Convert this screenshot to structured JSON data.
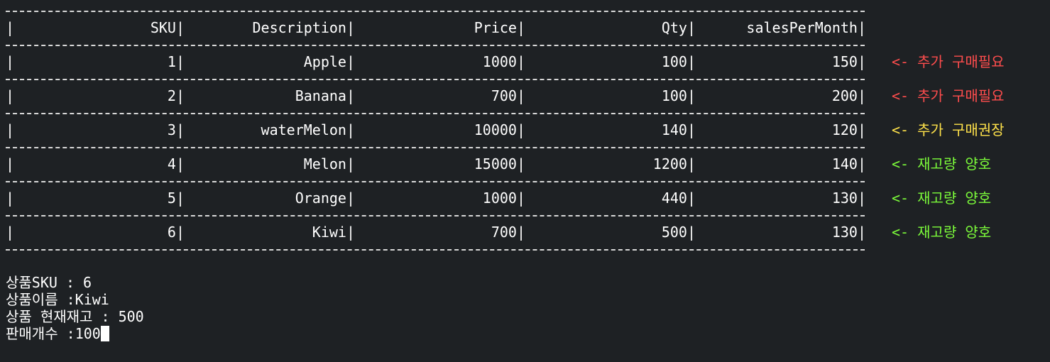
{
  "table": {
    "headers": [
      "SKU",
      "Description",
      "Price",
      "Qty",
      "salesPerMonth"
    ],
    "rows": [
      {
        "sku": "1",
        "description": "Apple",
        "price": "1000",
        "qty": "100",
        "sales": "150",
        "status_arrow": "<-",
        "status_text": "추가 구매필요",
        "status_color": "#ff4d4d"
      },
      {
        "sku": "2",
        "description": "Banana",
        "price": "700",
        "qty": "100",
        "sales": "200",
        "status_arrow": "<-",
        "status_text": "추가 구매필요",
        "status_color": "#ff4d4d"
      },
      {
        "sku": "3",
        "description": "waterMelon",
        "price": "10000",
        "qty": "140",
        "sales": "120",
        "status_arrow": "<-",
        "status_text": "추가 구매권장",
        "status_color": "#ffe24a"
      },
      {
        "sku": "4",
        "description": "Melon",
        "price": "15000",
        "qty": "1200",
        "sales": "140",
        "status_arrow": "<-",
        "status_text": "재고량 양호",
        "status_color": "#7cfc3a"
      },
      {
        "sku": "5",
        "description": "Orange",
        "price": "1000",
        "qty": "440",
        "sales": "130",
        "status_arrow": "<-",
        "status_text": "재고량 양호",
        "status_color": "#7cfc3a"
      },
      {
        "sku": "6",
        "description": "Kiwi",
        "price": "700",
        "qty": "500",
        "sales": "130",
        "status_arrow": "<-",
        "status_text": "재고량 양호",
        "status_color": "#7cfc3a"
      }
    ]
  },
  "prompt": {
    "lines": [
      "상품SKU : 6",
      "상품이름 :Kiwi",
      "상품 현재재고 : 500"
    ],
    "input_label": "판매개수 :",
    "input_value": "100"
  },
  "colors": {
    "background": "#1e2124",
    "text": "#ffffff",
    "red": "#ff4d4d",
    "yellow": "#ffe24a",
    "green": "#7cfc3a"
  }
}
